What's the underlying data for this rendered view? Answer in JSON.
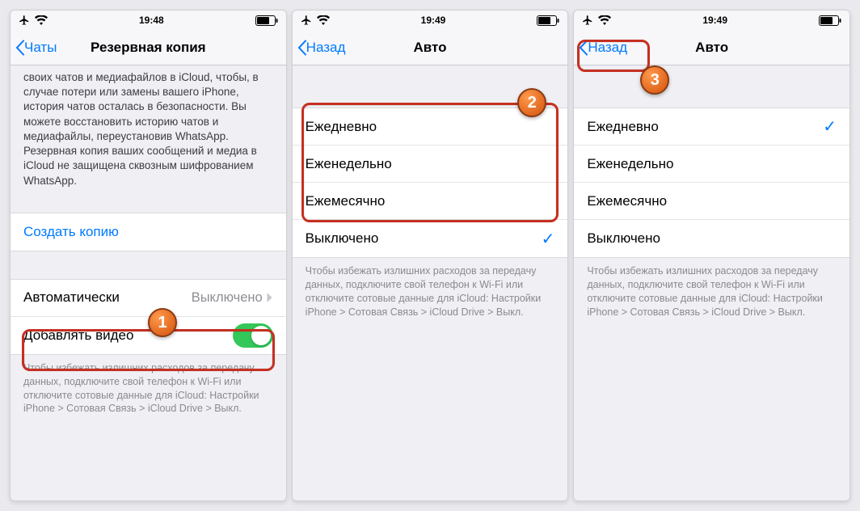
{
  "screens": [
    {
      "status_time": "19:48",
      "back_label": "Чаты",
      "title": "Резервная копия",
      "intro_note": "своих чатов и медиафайлов в iCloud, чтобы, в случае потери или замены вашего iPhone, история чатов осталась в безопасности. Вы можете восстановить историю чатов и медиафайлы, переустановив WhatsApp. Резервная копия ваших сообщений и медиа в iCloud не защищена сквозным шифрованием WhatsApp.",
      "create_backup_label": "Создать копию",
      "auto_row": {
        "label": "Автоматически",
        "value": "Выключено"
      },
      "video_row_label": "Добавлять видео",
      "footer": "Чтобы избежать излишних расходов за передачу данных, подключите свой телефон к Wi-Fi или отключите сотовые данные для iCloud: Настройки iPhone > Сотовая Связь > iCloud Drive > Выкл.",
      "step_badge": "1"
    },
    {
      "status_time": "19:49",
      "back_label": "Назад",
      "title": "Авто",
      "options": [
        "Ежедневно",
        "Еженедельно",
        "Ежемесячно",
        "Выключено"
      ],
      "selected_index": 3,
      "footer": "Чтобы избежать излишних расходов за передачу данных, подключите свой телефон к Wi-Fi или отключите сотовые данные для iCloud: Настройки iPhone > Сотовая Связь > iCloud Drive > Выкл.",
      "step_badge": "2"
    },
    {
      "status_time": "19:49",
      "back_label": "Назад",
      "title": "Авто",
      "options": [
        "Ежедневно",
        "Еженедельно",
        "Ежемесячно",
        "Выключено"
      ],
      "selected_index": 0,
      "footer": "Чтобы избежать излишних расходов за передачу данных, подключите свой телефон к Wi-Fi или отключите сотовые данные для iCloud: Настройки iPhone > Сотовая Связь > iCloud Drive > Выкл.",
      "step_badge": "3"
    }
  ]
}
